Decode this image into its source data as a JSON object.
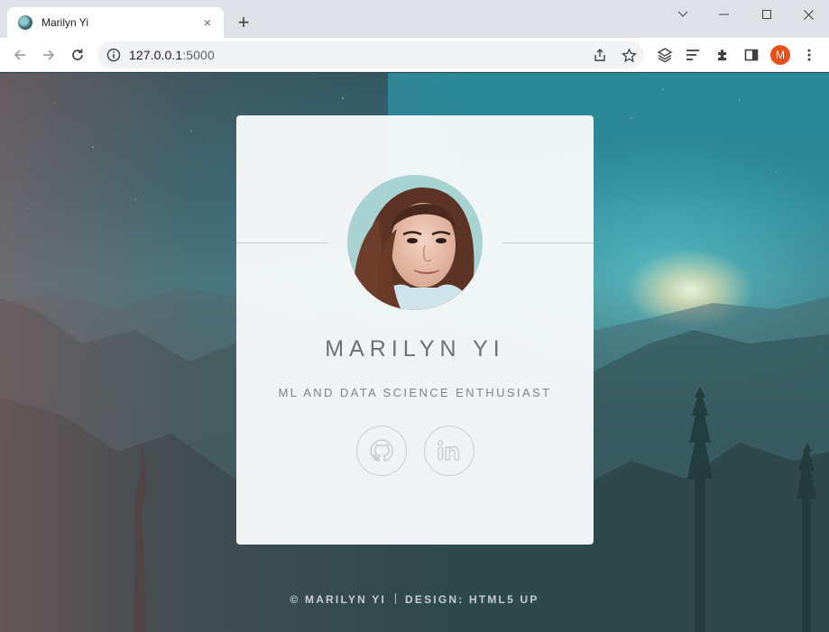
{
  "browser": {
    "tab": {
      "title": "Marilyn Yi",
      "favicon": "marilyn-favicon-icon",
      "close": "×"
    },
    "new_tab": "+",
    "address": {
      "host": "127.0.0.1",
      "port": ":5000"
    },
    "profile_initial": "M",
    "profile_color": "#e8501c"
  },
  "profile": {
    "name": "MARILYN YI",
    "tagline": "ML AND DATA SCIENCE ENTHUSIAST",
    "links": [
      {
        "icon": "github-icon"
      },
      {
        "icon": "linkedin-icon"
      }
    ]
  },
  "footer": {
    "copyright": "© MARILYN YI",
    "design": "DESIGN: HTML5 UP"
  }
}
